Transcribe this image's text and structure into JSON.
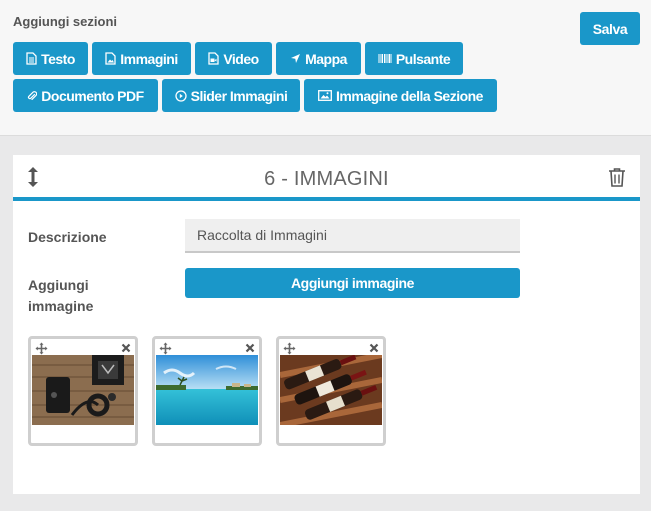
{
  "toolbar": {
    "title": "Aggiungi sezioni",
    "save_label": "Salva",
    "buttons": [
      {
        "label": "Testo",
        "icon": "file-text-icon"
      },
      {
        "label": "Immagini",
        "icon": "image-file-icon"
      },
      {
        "label": "Video",
        "icon": "video-file-icon"
      },
      {
        "label": "Mappa",
        "icon": "location-arrow-icon"
      },
      {
        "label": "Pulsante",
        "icon": "barcode-icon"
      },
      {
        "label": "Documento PDF",
        "icon": "paperclip-icon"
      },
      {
        "label": "Slider Immagini",
        "icon": "play-circle-icon"
      },
      {
        "label": "Immagine della Sezione",
        "icon": "picture-icon"
      }
    ]
  },
  "section": {
    "title": "6 - IMMAGINI",
    "description_label": "Descrizione",
    "description_value": "Raccolta di Immagini",
    "add_image_label_line1": "Aggiungi",
    "add_image_label_line2": "immagine",
    "add_image_button": "Aggiungi immagine",
    "images": [
      {
        "subject": "headphones and gadgets on wooden table"
      },
      {
        "subject": "tropical sea with overwater bungalows"
      },
      {
        "subject": "wine bottles in wooden rack"
      }
    ]
  },
  "colors": {
    "accent": "#1a97c9",
    "background": "#e9e9ea",
    "panel": "#ffffff"
  }
}
